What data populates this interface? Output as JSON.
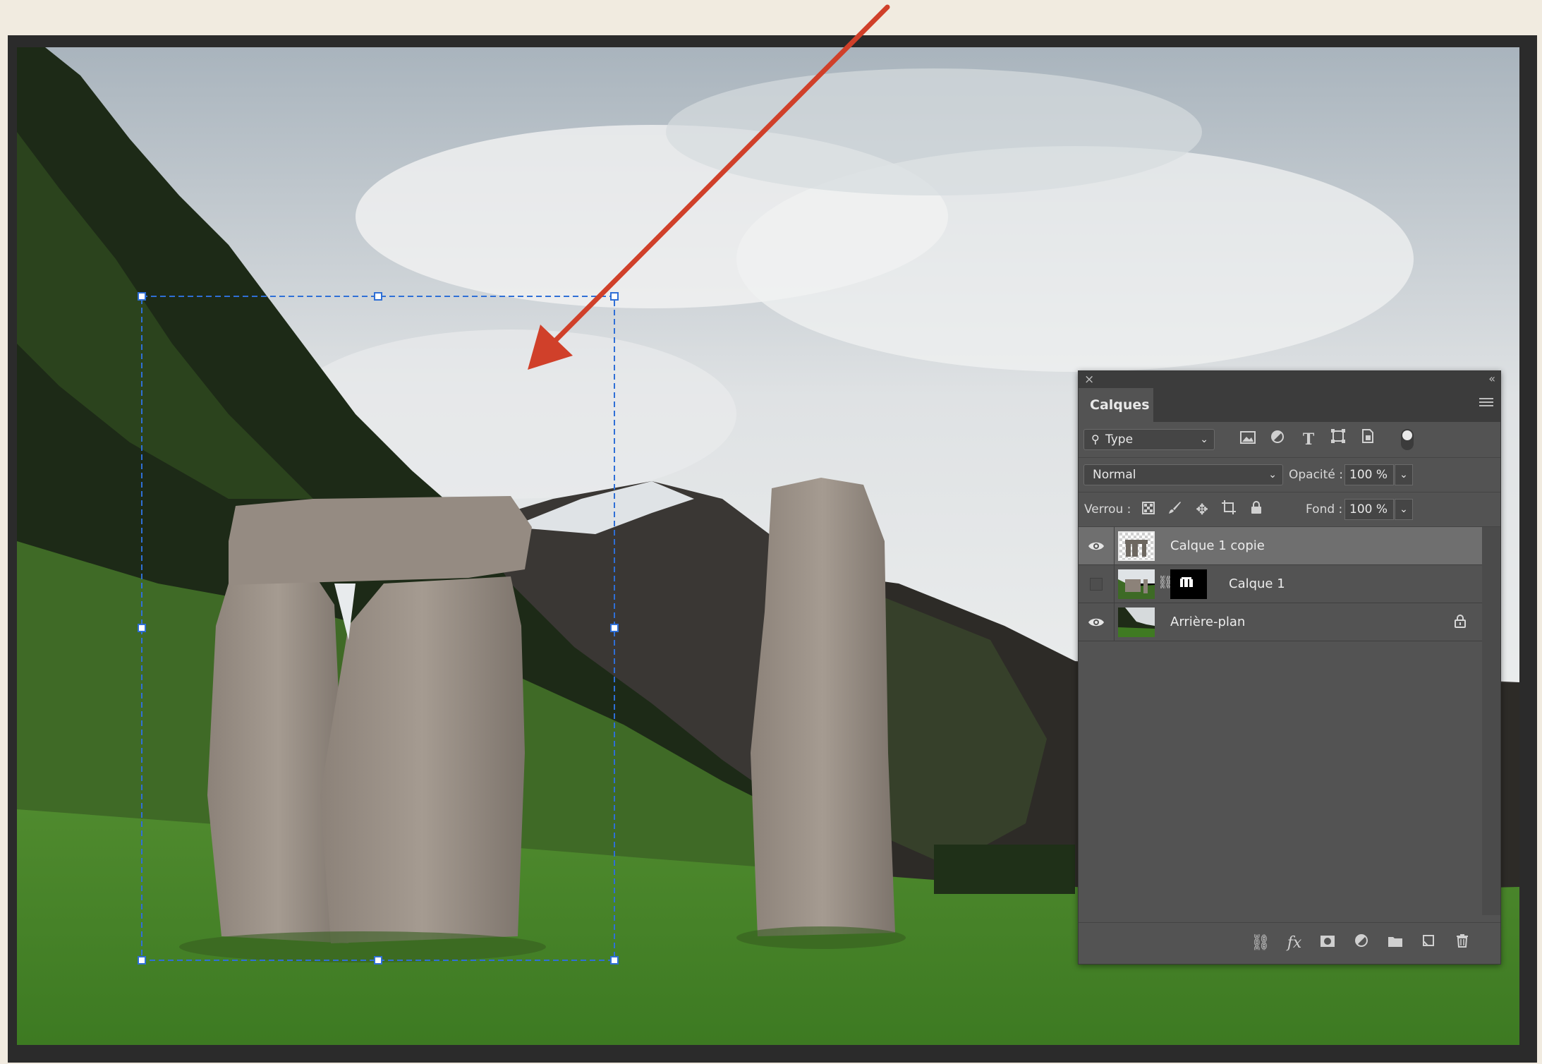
{
  "panel": {
    "title": "Calques",
    "filter": {
      "label": "Type",
      "icon": "search-icon"
    },
    "filter_icons": [
      "image-filter-icon",
      "adjustment-filter-icon",
      "type-filter-icon",
      "shape-filter-icon",
      "smart-object-filter-icon"
    ],
    "blend_mode": "Normal",
    "opacity_label": "Opacité :",
    "opacity_value": "100 %",
    "lock_label": "Verrou :",
    "lock_icons": [
      "lock-transparency-icon",
      "lock-paint-icon",
      "lock-position-icon",
      "lock-artboard-icon",
      "lock-all-icon"
    ],
    "fill_label": "Fond :",
    "fill_value": "100 %",
    "layers": [
      {
        "name": "Calque 1 copie",
        "visible": true,
        "selected": true
      },
      {
        "name": "Calque 1",
        "visible": false,
        "selected": false,
        "has_mask": true
      },
      {
        "name": "Arrière-plan",
        "visible": true,
        "selected": false,
        "locked": true
      }
    ],
    "bottom_icons": [
      "link-icon",
      "fx-icon",
      "mask-icon",
      "adjustment-icon",
      "folder-icon",
      "new-layer-icon",
      "trash-icon"
    ],
    "fx_text": "fx"
  },
  "annotation": {
    "arrow_color": "#d0402a"
  },
  "selection": {
    "color": "#2f6fd6"
  }
}
